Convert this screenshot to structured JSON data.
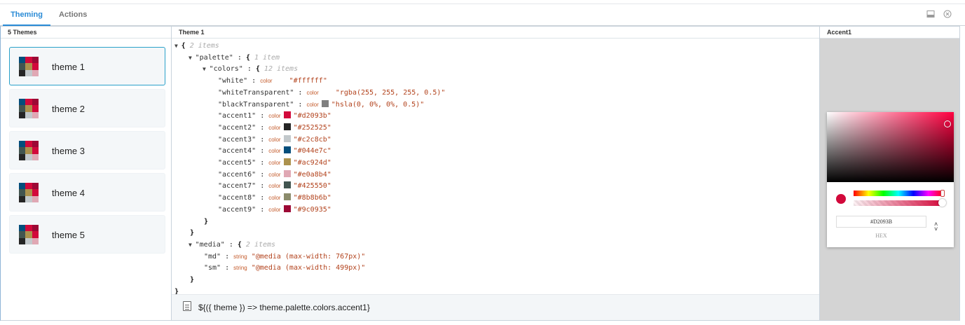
{
  "tabs": [
    {
      "label": "Theming",
      "active": true
    },
    {
      "label": "Actions",
      "active": false
    }
  ],
  "toolbar": {
    "dock_icon": "panel-dock-icon",
    "close_icon": "close-circle-icon"
  },
  "left_panel": {
    "title": "5 Themes",
    "themes": [
      {
        "label": "theme 1",
        "selected": true
      },
      {
        "label": "theme 2",
        "selected": false
      },
      {
        "label": "theme 3",
        "selected": false
      },
      {
        "label": "theme 4",
        "selected": false
      },
      {
        "label": "theme 5",
        "selected": false
      }
    ]
  },
  "middle_panel": {
    "title": "Theme 1",
    "root_meta": "2 items",
    "palette_key": "\"palette\"",
    "palette_meta": "1 item",
    "colors_key": "\"colors\"",
    "colors_meta": "12 items",
    "colors": [
      {
        "key": "\"white\"",
        "type": "color",
        "value": "\"#ffffff\"",
        "swatch": null
      },
      {
        "key": "\"whiteTransparent\"",
        "type": "color",
        "value": "\"rgba(255, 255, 255, 0.5)\"",
        "swatch": null
      },
      {
        "key": "\"blackTransparent\"",
        "type": "color",
        "value": "\"hsla(0, 0%, 0%, 0.5)\"",
        "swatch": "#7f7f7f"
      },
      {
        "key": "\"accent1\"",
        "type": "color",
        "value": "\"#d2093b\"",
        "swatch": "#d2093b"
      },
      {
        "key": "\"accent2\"",
        "type": "color",
        "value": "\"#252525\"",
        "swatch": "#252525"
      },
      {
        "key": "\"accent3\"",
        "type": "color",
        "value": "\"#c2c8cb\"",
        "swatch": "#c2c8cb"
      },
      {
        "key": "\"accent4\"",
        "type": "color",
        "value": "\"#044e7c\"",
        "swatch": "#044e7c"
      },
      {
        "key": "\"accent5\"",
        "type": "color",
        "value": "\"#ac924d\"",
        "swatch": "#ac924d"
      },
      {
        "key": "\"accent6\"",
        "type": "color",
        "value": "\"#e0a8b4\"",
        "swatch": "#e0a8b4"
      },
      {
        "key": "\"accent7\"",
        "type": "color",
        "value": "\"#425550\"",
        "swatch": "#425550"
      },
      {
        "key": "\"accent8\"",
        "type": "color",
        "value": "\"#8b8b6b\"",
        "swatch": "#8b8b6b"
      },
      {
        "key": "\"accent9\"",
        "type": "color",
        "value": "\"#9c0935\"",
        "swatch": "#9c0935"
      }
    ],
    "media_key": "\"media\"",
    "media_meta": "2 items",
    "media": [
      {
        "key": "\"md\"",
        "type": "string",
        "value": "\"@media (max-width: 767px)\""
      },
      {
        "key": "\"sm\"",
        "type": "string",
        "value": "\"@media (max-width: 499px)\""
      }
    ],
    "footer_expression": "${({ theme }) => theme.palette.colors.accent1}"
  },
  "right_panel": {
    "title": "Accent1",
    "picker": {
      "current_color": "#d2093b",
      "hex_value": "#D2093B",
      "mode_label": "HEX"
    }
  },
  "swatch_colors": [
    "#044e7c",
    "#d2093b",
    "#9c0935",
    "#425550",
    "#ac924d",
    "#d2093b",
    "#252525",
    "#c2c8cb",
    "#e0a8b4"
  ]
}
